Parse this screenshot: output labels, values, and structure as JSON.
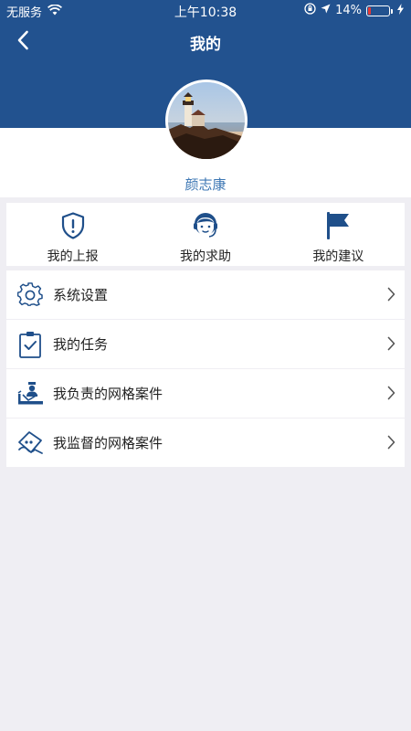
{
  "status_bar": {
    "carrier": "无服务",
    "time": "上午10:38",
    "battery_percent": "14%",
    "battery_level": 0.14
  },
  "nav": {
    "title": "我的"
  },
  "profile": {
    "username": "颜志康"
  },
  "quick_actions": [
    {
      "label": "我的上报",
      "icon": "shield-alert-icon"
    },
    {
      "label": "我的求助",
      "icon": "headset-person-icon"
    },
    {
      "label": "我的建议",
      "icon": "flag-icon"
    }
  ],
  "menu": [
    {
      "label": "系统设置",
      "icon": "gear-icon"
    },
    {
      "label": "我的任务",
      "icon": "clipboard-check-icon"
    },
    {
      "label": "我负责的网格案件",
      "icon": "desk-person-icon"
    },
    {
      "label": "我监督的网格案件",
      "icon": "supervise-icon"
    }
  ],
  "colors": {
    "header_bg": "#22528f",
    "accent": "#3d77b4",
    "icon": "#1f4f8a",
    "page_bg": "#efeef3"
  }
}
